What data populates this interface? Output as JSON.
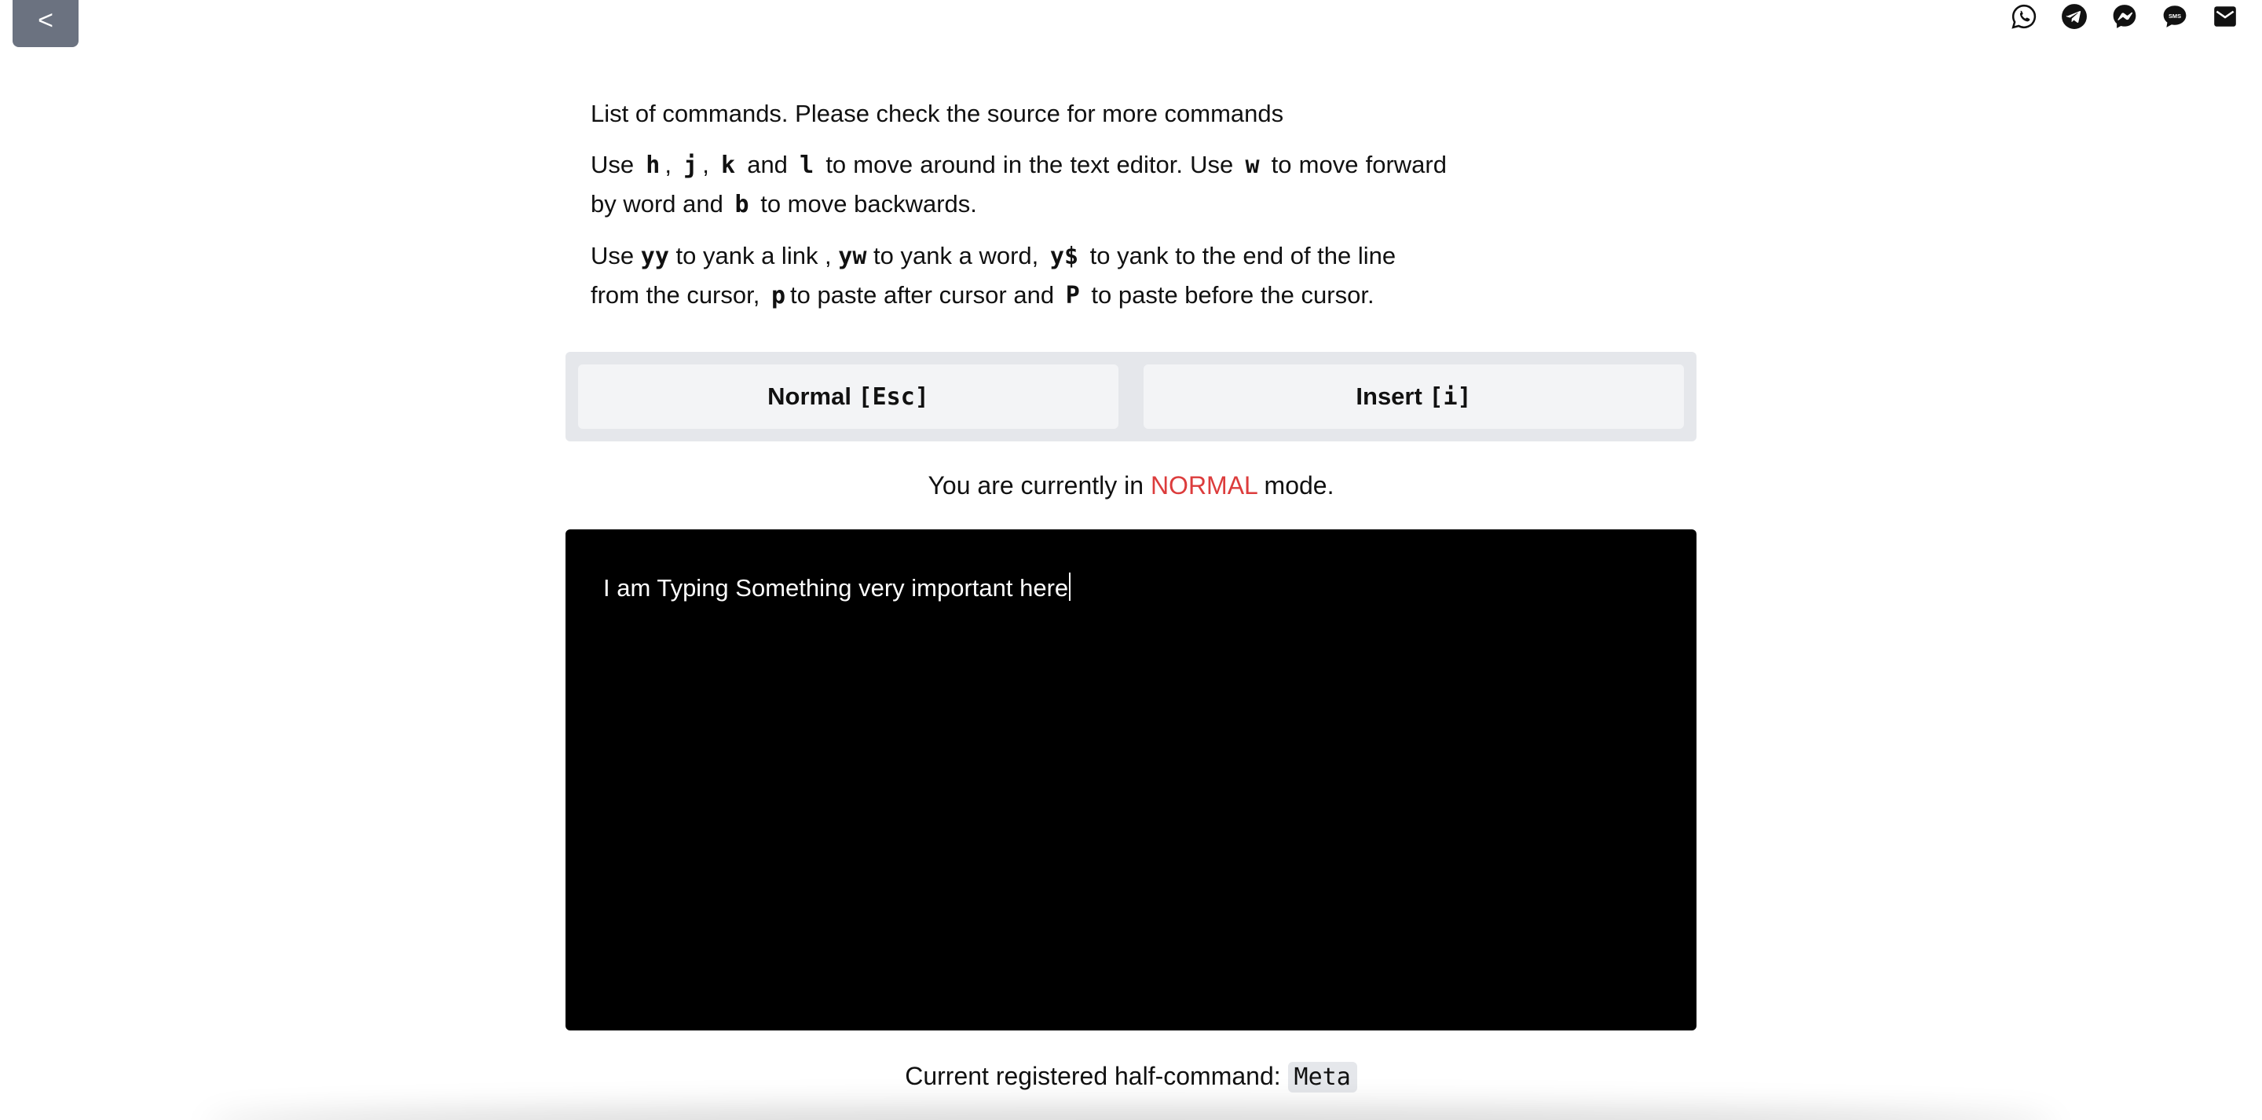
{
  "nav": {
    "back_label": "<"
  },
  "share": {
    "icons": [
      "whatsapp-icon",
      "telegram-icon",
      "messenger-icon",
      "sms-icon",
      "email-icon"
    ],
    "sms_text": "SMS"
  },
  "instructions": {
    "heading": "List of commands. Please check the source for more commands",
    "movement": {
      "use": "Use",
      "k_h": "h",
      "comma1": ",",
      "k_j": "j",
      "comma2": ",",
      "k_k": "k",
      "and1": "and",
      "k_l": "l",
      "t1": "to move around in the text editor. Use",
      "k_w": "w",
      "t2": "to move forward by word and",
      "k_b": "b",
      "t3": "to move backwards."
    },
    "yank": {
      "use": "Use",
      "k_yy": "yy",
      "t1": "to yank a link ,",
      "k_yw": "yw",
      "t2": "to yank a word,",
      "k_ydollar": "y$",
      "t3": "to yank to the end of the line from the cursor,",
      "k_p": "p",
      "t4": "to paste after cursor and",
      "k_P": "P",
      "t5": "to paste before the cursor."
    }
  },
  "modes": {
    "normal_label": "Normal ",
    "normal_key": "[Esc]",
    "insert_label": "Insert ",
    "insert_key": "[i]"
  },
  "status": {
    "prefix": "You are currently in",
    "mode": "NORMAL",
    "suffix": "mode."
  },
  "editor": {
    "text": "I am Typing Something very important here"
  },
  "half_command": {
    "label": "Current registered half-command:",
    "value": "Meta"
  },
  "colors": {
    "mode_word": "#dc3c3c",
    "back_button": "#6b7280",
    "editor_bg": "#000000"
  }
}
